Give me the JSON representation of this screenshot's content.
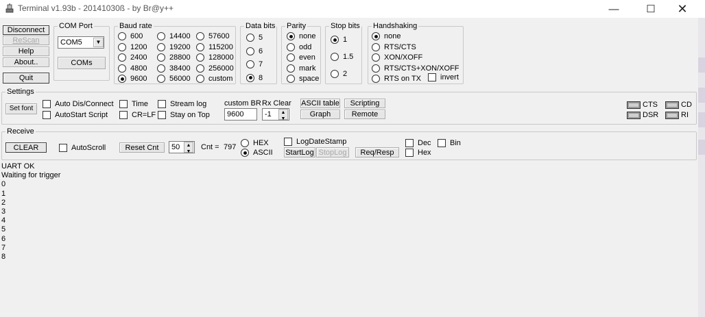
{
  "window": {
    "title": "Terminal v1.93b - 20141030ß - by Br@y++",
    "minimize_icon": "minimize-icon",
    "maximize_icon": "maximize-icon",
    "close_icon": "close-icon"
  },
  "left_buttons": {
    "disconnect": "Disconnect",
    "rescan": "ReScan",
    "help": "Help",
    "about": "About..",
    "quit": "Quit"
  },
  "com_port": {
    "label": "COM Port",
    "value": "COM5",
    "coms_button": "COMs"
  },
  "baud_rate": {
    "label": "Baud rate",
    "options": [
      "600",
      "1200",
      "2400",
      "4800",
      "9600",
      "14400",
      "19200",
      "28800",
      "38400",
      "56000",
      "57600",
      "115200",
      "128000",
      "256000",
      "custom"
    ],
    "selected": "9600"
  },
  "data_bits": {
    "label": "Data bits",
    "options": [
      "5",
      "6",
      "7",
      "8"
    ],
    "selected": "8"
  },
  "parity": {
    "label": "Parity",
    "options": [
      "none",
      "odd",
      "even",
      "mark",
      "space"
    ],
    "selected": "none"
  },
  "stop_bits": {
    "label": "Stop bits",
    "options": [
      "1",
      "1.5",
      "2"
    ],
    "selected": "1"
  },
  "handshaking": {
    "label": "Handshaking",
    "options": [
      "none",
      "RTS/CTS",
      "XON/XOFF",
      "RTS/CTS+XON/XOFF",
      "RTS on TX"
    ],
    "selected": "none",
    "invert_label": "invert"
  },
  "settings": {
    "label": "Settings",
    "set_font": "Set font",
    "auto_dis_connect": "Auto Dis/Connect",
    "autostart_script": "AutoStart Script",
    "time": "Time",
    "cr_lf": "CR=LF",
    "stream_log": "Stream log",
    "stay_on_top": "Stay on Top",
    "custom_br_label": "custom BR",
    "custom_br_value": "9600",
    "rx_clear_label": "Rx Clear",
    "rx_clear_value": "-1",
    "ascii_table": "ASCII table",
    "graph": "Graph",
    "scripting": "Scripting",
    "remote": "Remote"
  },
  "indicators": {
    "cts": "CTS",
    "cd": "CD",
    "dsr": "DSR",
    "ri": "RI"
  },
  "receive": {
    "label": "Receive",
    "clear": "CLEAR",
    "autoscroll": "AutoScroll",
    "reset_cnt": "Reset Cnt",
    "reset_cnt_value": "50",
    "cnt_label": "Cnt =",
    "cnt_value": "797",
    "hex": "HEX",
    "ascii": "ASCII",
    "mode_selected": "ASCII",
    "log_date_stamp": "LogDateStamp",
    "start_log": "StartLog",
    "stop_log": "StopLog",
    "req_resp": "Req/Resp",
    "dec": "Dec",
    "hex_check": "Hex",
    "bin": "Bin"
  },
  "output_lines": [
    "UART OK",
    "Waiting for trigger",
    "0",
    "1",
    "2",
    "3",
    "4",
    "5",
    "6",
    "7",
    "8"
  ]
}
